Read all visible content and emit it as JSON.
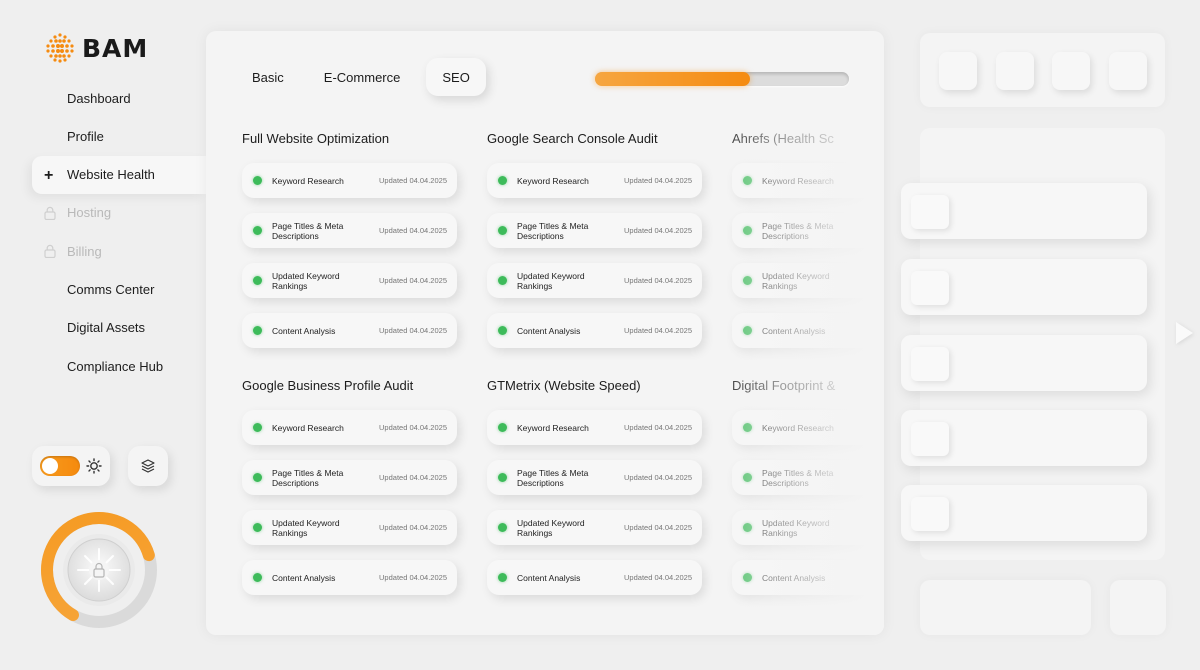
{
  "brand": {
    "name": "BAM",
    "accent": "#f58b10",
    "status_green": "#3dbb5a"
  },
  "sidebar": {
    "items": [
      {
        "label": "Dashboard",
        "state": "normal"
      },
      {
        "label": "Profile",
        "state": "normal"
      },
      {
        "label": "Website Health",
        "state": "active",
        "icon": "plus-icon"
      },
      {
        "label": "Hosting",
        "state": "locked",
        "icon": "lock-icon"
      },
      {
        "label": "Billing",
        "state": "locked",
        "icon": "lock-icon"
      },
      {
        "label": "Comms Center",
        "state": "normal"
      },
      {
        "label": "Digital Assets",
        "state": "normal"
      },
      {
        "label": "Compliance Hub",
        "state": "normal"
      }
    ],
    "theme_toggle": {
      "on": true,
      "icon": "sun-icon"
    },
    "layers_icon": "layers-icon",
    "dial": {
      "level": 0.62,
      "icon": "lock-icon"
    }
  },
  "main": {
    "tabs": [
      {
        "label": "Basic",
        "active": false
      },
      {
        "label": "E-Commerce",
        "active": false
      },
      {
        "label": "SEO",
        "active": true
      }
    ],
    "progress": 0.61,
    "groups": [
      {
        "title": "Full Website Optimization",
        "items": [
          {
            "label": "Keyword Research",
            "updated": "Updated 04.04.2025"
          },
          {
            "label": "Page Titles & Meta Descriptions",
            "updated": "Updated 04.04.2025"
          },
          {
            "label": "Updated Keyword Rankings",
            "updated": "Updated 04.04.2025"
          },
          {
            "label": "Content Analysis",
            "updated": "Updated 04.04.2025"
          }
        ]
      },
      {
        "title": "Google Search Console Audit",
        "items": [
          {
            "label": "Keyword Research",
            "updated": "Updated 04.04.2025"
          },
          {
            "label": "Page Titles & Meta Descriptions",
            "updated": "Updated 04.04.2025"
          },
          {
            "label": "Updated Keyword Rankings",
            "updated": "Updated 04.04.2025"
          },
          {
            "label": "Content Analysis",
            "updated": "Updated 04.04.2025"
          }
        ]
      },
      {
        "title": "Ahrefs (Health Sc",
        "items": [
          {
            "label": "Keyword Research",
            "updated": ""
          },
          {
            "label": "Page Titles & Meta Descriptions",
            "updated": ""
          },
          {
            "label": "Updated Keyword Rankings",
            "updated": ""
          },
          {
            "label": "Content Analysis",
            "updated": ""
          }
        ]
      },
      {
        "title": "Google Business Profile Audit",
        "items": [
          {
            "label": "Keyword Research",
            "updated": "Updated 04.04.2025"
          },
          {
            "label": "Page Titles & Meta Descriptions",
            "updated": "Updated 04.04.2025"
          },
          {
            "label": "Updated Keyword Rankings",
            "updated": "Updated 04.04.2025"
          },
          {
            "label": "Content Analysis",
            "updated": "Updated 04.04.2025"
          }
        ]
      },
      {
        "title": "GTMetrix (Website Speed)",
        "items": [
          {
            "label": "Keyword Research",
            "updated": "Updated 04.04.2025"
          },
          {
            "label": "Page Titles & Meta Descriptions",
            "updated": "Updated 04.04.2025"
          },
          {
            "label": "Updated Keyword Rankings",
            "updated": "Updated 04.04.2025"
          },
          {
            "label": "Content Analysis",
            "updated": "Updated 04.04.2025"
          }
        ]
      },
      {
        "title": "Digital Footprint &",
        "items": [
          {
            "label": "Keyword Research",
            "updated": ""
          },
          {
            "label": "Page Titles & Meta Descriptions",
            "updated": ""
          },
          {
            "label": "Updated Keyword Rankings",
            "updated": ""
          },
          {
            "label": "Content Analysis",
            "updated": ""
          }
        ]
      }
    ]
  }
}
